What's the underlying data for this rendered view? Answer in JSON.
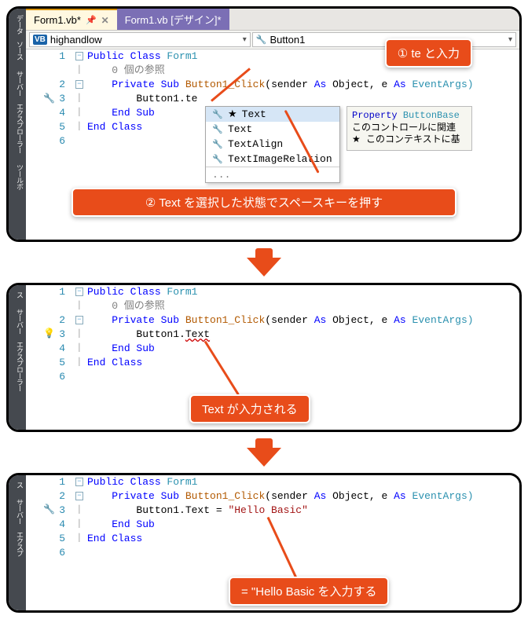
{
  "tabs": {
    "active": "Form1.vb*",
    "inactive": "Form1.vb [デザイン]*"
  },
  "selectors": {
    "left": "highandlow",
    "right": "Button1"
  },
  "sidebar": {
    "a": "データ ソース",
    "b": "サーバー エクスプローラー",
    "c": "ツールボ"
  },
  "sidebar2": {
    "a": "ス",
    "b": "サーバー エクスプローラー"
  },
  "sidebar3": {
    "a": "ス",
    "b": "サーバー エクスプ"
  },
  "callouts": {
    "c1": "① te と入力",
    "c2": "② Text を選択した状態でスペースキーを押す",
    "c3": "Text が入力される",
    "c4": "= \"Hello Basic  を入力する"
  },
  "code1": {
    "l1a": "Public",
    "l1b": " Class ",
    "l1c": "Form1",
    "ref": "    0 個の参照",
    "l2a": "Private",
    "l2b": " Sub ",
    "l2c": "Button1_Click",
    "l2d": "(sender ",
    "l2e": "As",
    "l2f": " Object, e ",
    "l2g": "As",
    "l2h": " EventArgs)",
    "l3a": "Button1.te",
    "l4a": "End",
    "l4b": " Sub",
    "l5a": "End",
    "l5b": " Class"
  },
  "code2": {
    "l3a": "Button1.",
    "l3b": "Text"
  },
  "code3": {
    "l3a": "Button1.Text = ",
    "l3b": "\"Hello Basic\""
  },
  "intellisense": {
    "i1": "Text",
    "i2": "Text",
    "i3": "TextAlign",
    "i4": "TextImageRelation"
  },
  "tooltip": {
    "hdr": "Property ",
    "hdr2": "ButtonBase",
    "body1": "このコントロールに関連",
    "body2": "★ このコンテキストに基"
  },
  "lineNums": [
    "1",
    "2",
    "3",
    "4",
    "5",
    "6"
  ]
}
